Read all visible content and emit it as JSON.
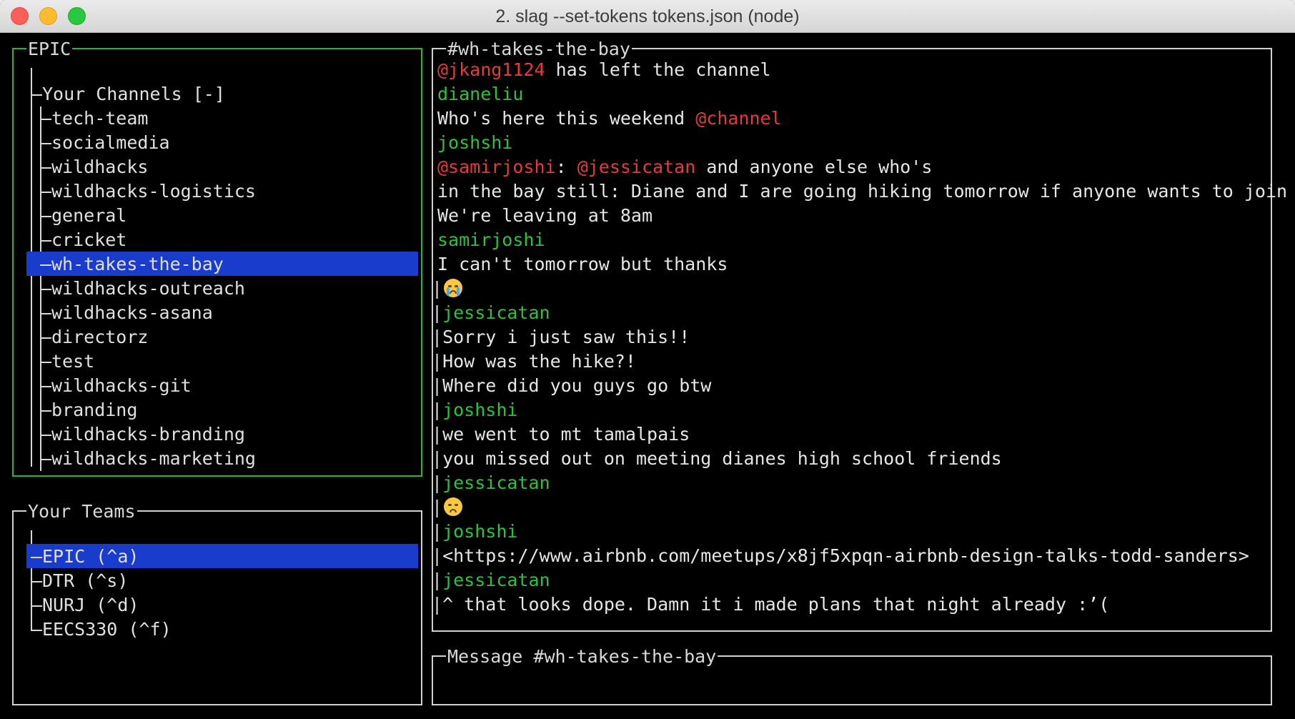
{
  "window": {
    "title": "2. slag --set-tokens tokens.json (node)"
  },
  "colors": {
    "green": "#28c53c",
    "red": "#e73a3a",
    "selection": "#1a3ccc"
  },
  "channels_panel": {
    "label": "EPIC",
    "header": "Your Channels [-]",
    "selected": "wh-takes-the-bay",
    "items": [
      "tech-team",
      "socialmedia",
      "wildhacks",
      "wildhacks-logistics",
      "general",
      "cricket",
      "wh-takes-the-bay",
      "wildhacks-outreach",
      "wildhacks-asana",
      "directorz",
      "test",
      "wildhacks-git",
      "branding",
      "wildhacks-branding",
      "wildhacks-marketing"
    ]
  },
  "teams_panel": {
    "label": "Your Teams",
    "selected": "EPIC (^a)",
    "items": [
      "EPIC (^a)",
      "DTR (^s)",
      "NURJ (^d)",
      "EECS330 (^f)"
    ]
  },
  "chat_panel": {
    "label": "#wh-takes-the-bay",
    "lines": [
      {
        "mention": "@jkang1124",
        "text": " has left the channel"
      },
      {
        "user": "dianeliu"
      },
      {
        "text": "Who's here this weekend ",
        "mention_end": "@channel"
      },
      {
        "user": "joshshi"
      },
      {
        "mention": "@samirjoshi",
        "mid": ": ",
        "mention2": "@jessicatan",
        "text": " and anyone else who's"
      },
      {
        "text": "in the bay still: Diane and I are going hiking tomorrow if anyone wants to join"
      },
      {
        "text": "We're leaving at 8am"
      },
      {
        "user": "samirjoshi"
      },
      {
        "text": "I can't tomorrow but thanks"
      },
      {
        "pipe": "|",
        "emoji": "crying-face"
      },
      {
        "pipe": "|",
        "user": "jessicatan"
      },
      {
        "pipe": "|",
        "text": "Sorry i just saw this!!"
      },
      {
        "pipe": "|",
        "text": "How was the hike?!"
      },
      {
        "pipe": "|",
        "text": "Where did you guys go btw"
      },
      {
        "pipe": "|",
        "user": "joshshi"
      },
      {
        "pipe": "|",
        "text": "we went to mt tamalpais"
      },
      {
        "pipe": "|",
        "text": "you missed out on meeting dianes high school friends"
      },
      {
        "pipe": "|",
        "user": "jessicatan"
      },
      {
        "pipe": "|",
        "emoji": "pensive-face"
      },
      {
        "pipe": "|",
        "user": "joshshi"
      },
      {
        "pipe": "|",
        "text": "<https://www.airbnb.com/meetups/x8jf5xpqn-airbnb-design-talks-todd-sanders>"
      },
      {
        "pipe": "|",
        "user": "jessicatan"
      },
      {
        "pipe": "|",
        "text": "^ that looks dope. Damn it i made plans that night already :’("
      }
    ]
  },
  "input_panel": {
    "label": "Message #wh-takes-the-bay",
    "value": ""
  }
}
